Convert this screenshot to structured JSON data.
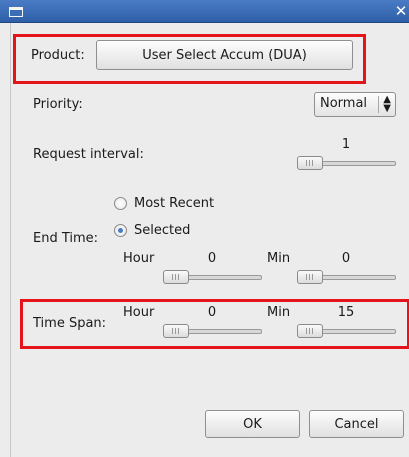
{
  "window": {
    "title": "",
    "colors": {
      "titlebar": "#3b6fba",
      "highlight": "#e4141b",
      "background": "#ececec"
    }
  },
  "product": {
    "label": "Product:",
    "button_label": "User Select Accum (DUA)"
  },
  "priority": {
    "label": "Priority:",
    "selected": "Normal"
  },
  "request_interval": {
    "label": "Request interval:",
    "value": "1"
  },
  "end_time": {
    "label": "End Time:",
    "options": [
      "Most Recent",
      "Selected"
    ],
    "selected_option": "Selected",
    "hour_label": "Hour",
    "hour_value": "0",
    "min_label": "Min",
    "min_value": "0"
  },
  "time_span": {
    "label": "Time Span:",
    "hour_label": "Hour",
    "hour_value": "0",
    "min_label": "Min",
    "min_value": "15"
  },
  "buttons": {
    "ok": "OK",
    "cancel": "Cancel"
  }
}
